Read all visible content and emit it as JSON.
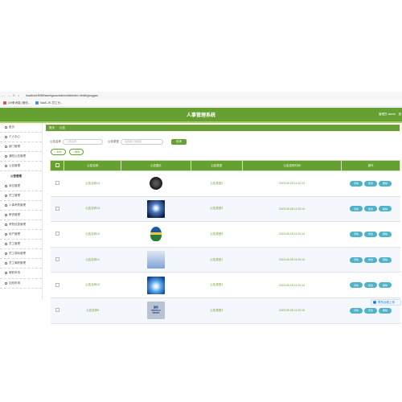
{
  "browser": {
    "nav": [
      "←",
      "→",
      "↻",
      "⌂"
    ],
    "url": "localhost:8080/ssmhgaux/admin/dist/index.html#/gonggao",
    "bookmarks": [
      {
        "label": "(39条消息) 微信..."
      },
      {
        "label": "SaaS-JK-员工分..."
      }
    ]
  },
  "header": {
    "title": "人事管理系统",
    "user": "管理员 admin",
    "exit": "退"
  },
  "sidebar": {
    "items": [
      {
        "label": "首页"
      },
      {
        "label": "个人中心"
      },
      {
        "label": "部门管理"
      },
      {
        "label": "通知公告管理"
      },
      {
        "label": "公告管理"
      },
      {
        "label": "公告管理",
        "sub": true
      },
      {
        "label": "岗位管理"
      },
      {
        "label": "员工管理"
      },
      {
        "label": "人事考勤管理"
      },
      {
        "label": "薪资管理"
      },
      {
        "label": "考勤信息管理"
      },
      {
        "label": "用户管理"
      },
      {
        "label": "员工管理"
      },
      {
        "label": "员工调动管理"
      },
      {
        "label": "员工离职管理"
      },
      {
        "label": "离职申请"
      },
      {
        "label": "加班申请"
      }
    ]
  },
  "breadcrumb": {
    "home": "首页",
    "current": "公告"
  },
  "search": {
    "label1": "公告名称",
    "placeholder1": "公告名称",
    "label2": "公告类型",
    "placeholder2": "请选择公告类型",
    "button": "查询"
  },
  "actions": {
    "add": "+ 新增",
    "delete": "× 删除"
  },
  "table": {
    "headers": [
      "公告名称",
      "公告图片",
      "公告类型",
      "公告发布时间",
      "操作"
    ],
    "rows": [
      {
        "name": "公告名称14",
        "type": "公告类型2",
        "time": "2023-09-05 11:20:13"
      },
      {
        "name": "公告名称13",
        "type": "公告类型3",
        "time": "2023-09-05 11:20:13"
      },
      {
        "name": "公告名称12",
        "type": "公告类型3",
        "time": "2023-09-05 11:20:13"
      },
      {
        "name": "公告名称11",
        "type": "公告类型1",
        "time": "2023-09-05 11:20:13"
      },
      {
        "name": "公告名称10",
        "type": "公告类型3",
        "time": "2023-09-05 11:20:13"
      },
      {
        "name": "公告名称9",
        "type": "公告类型3",
        "time": "2023-09-05 11:20:13"
      }
    ],
    "ops": [
      "详情",
      "修改",
      "删除"
    ],
    "thumb6_text": [
      "国际",
      "WORLD",
      "NEWS"
    ]
  },
  "tip": {
    "label": "联系远程上传"
  },
  "colors": {
    "primary": "#66a032",
    "accent_stripe": "#a6d060",
    "op_button": "#4fb2c8"
  }
}
